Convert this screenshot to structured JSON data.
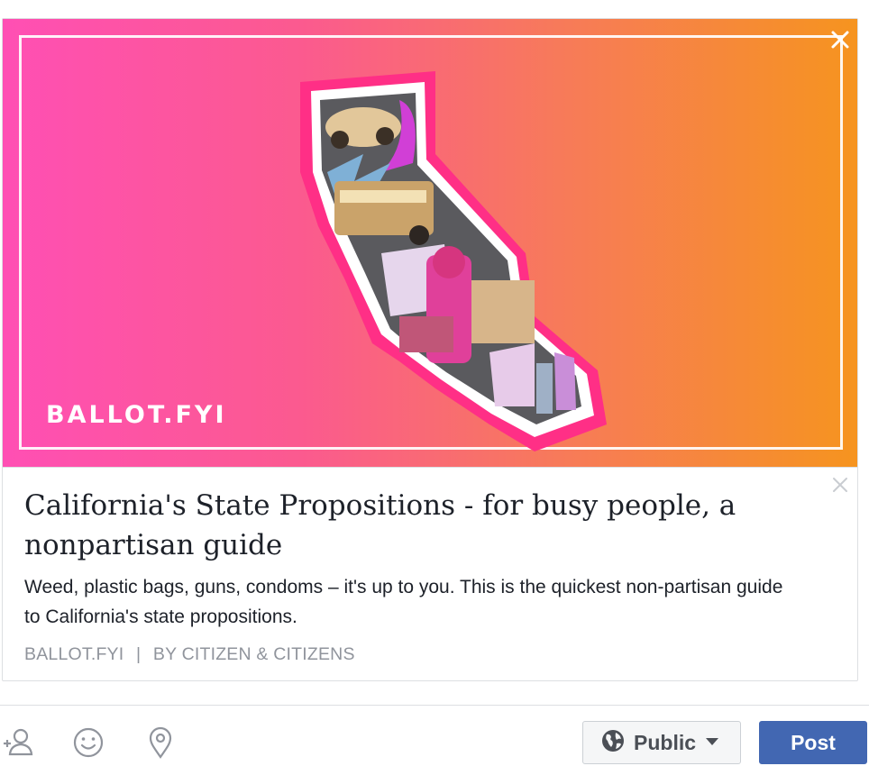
{
  "link_preview": {
    "brand_text": "BALLOT.FYI",
    "title": "California's State Propositions - for busy people, a nonpartisan guide",
    "description": "Weed, plastic bags, guns, condoms – it's up to you. This is the quickest non-partisan guide to California's state propositions.",
    "meta": {
      "domain": "BALLOT.FYI",
      "separator": "|",
      "author": "BY CITIZEN & CITIZENS"
    },
    "gradient_colors": [
      "#ff4fb4",
      "#f77a5a",
      "#f6941f"
    ]
  },
  "toolbar": {
    "icons": [
      "tag-friends-icon",
      "feeling-icon",
      "location-icon"
    ]
  },
  "audience": {
    "label": "Public",
    "icon": "globe-icon"
  },
  "post_button": {
    "label": "Post",
    "color": "#4267b2"
  }
}
